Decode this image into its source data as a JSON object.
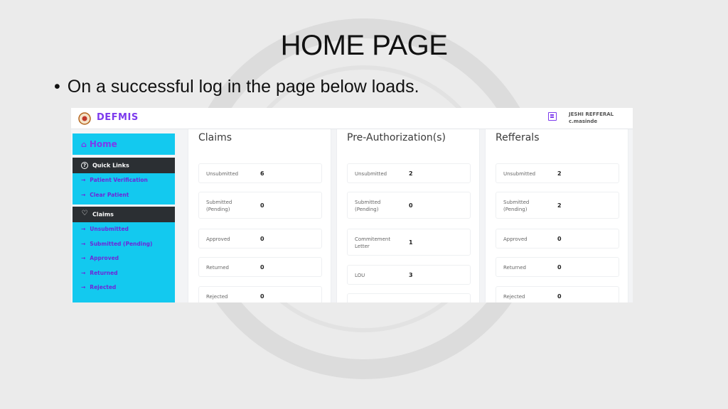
{
  "slide": {
    "title": "HOME PAGE",
    "bullet": "On a successful log in the page below loads."
  },
  "app": {
    "brand": "DEFMIS",
    "user_line1": "JESHI REFFERAL",
    "user_line2": "c.masinde",
    "accent_color": "#7c3aed",
    "sidebar_color": "#13c9ef"
  },
  "sidebar": {
    "home_label": "Home",
    "quick_links_title": "Quick Links",
    "quick_links": [
      "Patient Verification",
      "Clear Patient"
    ],
    "claims_title": "Claims",
    "claims_links": [
      "Unsubmitted",
      "Submitted (Pending)",
      "Approved",
      "Returned",
      "Rejected"
    ]
  },
  "claims": {
    "title": "Claims",
    "items": [
      {
        "label": "Unsubmitted",
        "value": "6"
      },
      {
        "label": "Submitted (Pending)",
        "value": "0"
      },
      {
        "label": "Approved",
        "value": "0"
      },
      {
        "label": "Returned",
        "value": "0"
      },
      {
        "label": "Rejected",
        "value": "0"
      }
    ]
  },
  "preauth": {
    "title": "Pre-Authorization(s)",
    "items": [
      {
        "label": "Unsubmitted",
        "value": "2"
      },
      {
        "label": "Submitted (Pending)",
        "value": "0"
      },
      {
        "label": "Commitement Letter",
        "value": "1"
      },
      {
        "label": "LOU",
        "value": "3"
      }
    ]
  },
  "referrals": {
    "title": "Refferals",
    "items": [
      {
        "label": "Unsubmitted",
        "value": "2"
      },
      {
        "label": "Submitted (Pending)",
        "value": "2"
      },
      {
        "label": "Approved",
        "value": "0"
      },
      {
        "label": "Returned",
        "value": "0"
      },
      {
        "label": "Rejected",
        "value": "0"
      }
    ]
  }
}
